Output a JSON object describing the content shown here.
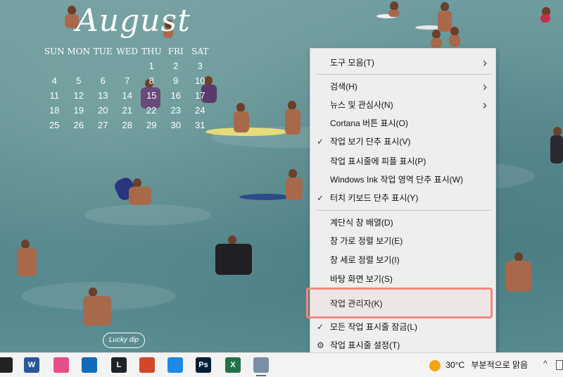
{
  "calendar": {
    "month": "August",
    "weekdays": [
      "SUN",
      "MON",
      "TUE",
      "WED",
      "THU",
      "FRI",
      "SAT"
    ],
    "weeks": [
      [
        "",
        "",
        "",
        "",
        "1",
        "2",
        "3"
      ],
      [
        "4",
        "5",
        "6",
        "7",
        "8",
        "9",
        "10"
      ],
      [
        "11",
        "12",
        "13",
        "14",
        "15",
        "16",
        "17"
      ],
      [
        "18",
        "19",
        "20",
        "21",
        "22",
        "23",
        "24"
      ],
      [
        "25",
        "26",
        "27",
        "28",
        "29",
        "30",
        "31"
      ]
    ],
    "sticker": "Lucky dip"
  },
  "context_menu": {
    "items": [
      {
        "label": "도구 모음(T)",
        "submenu": true,
        "checked": false
      },
      {
        "label": "검색(H)",
        "submenu": true,
        "checked": false
      },
      {
        "label": "뉴스 및 관심사(N)",
        "submenu": true,
        "checked": false
      },
      {
        "label": "Cortana 버튼 표시(O)",
        "submenu": false,
        "checked": false
      },
      {
        "label": "작업 보기 단추 표시(V)",
        "submenu": false,
        "checked": true
      },
      {
        "label": "작업 표시줄에 피플 표시(P)",
        "submenu": false,
        "checked": false
      },
      {
        "label": "Windows Ink 작업 영역 단추 표시(W)",
        "submenu": false,
        "checked": false
      },
      {
        "label": "터치 키보드 단추 표시(Y)",
        "submenu": false,
        "checked": true
      },
      {
        "label": "계단식 창 배열(D)",
        "submenu": false,
        "checked": false
      },
      {
        "label": "창 가로 정렬 보기(E)",
        "submenu": false,
        "checked": false
      },
      {
        "label": "창 세로 정렬 보기(I)",
        "submenu": false,
        "checked": false
      },
      {
        "label": "바탕 화면 보기(S)",
        "submenu": false,
        "checked": false
      },
      {
        "label": "작업 관리자(K)",
        "submenu": false,
        "checked": false,
        "highlighted": true
      },
      {
        "label": "모든 작업 표시줄 잠금(L)",
        "submenu": false,
        "checked": true
      },
      {
        "label": "작업 표시줄 설정(T)",
        "submenu": false,
        "checked": false,
        "icon": "gear-icon"
      }
    ],
    "check_glyph": "✓",
    "arrow_glyph": "›",
    "gear_glyph": "⚙",
    "highlight_color": "#f08a80"
  },
  "taskbar": {
    "apps": [
      {
        "name": "media-app-icon",
        "color": "#222222"
      },
      {
        "name": "word-icon",
        "color": "#2b579a",
        "glyph": "W"
      },
      {
        "name": "snip-tool-icon",
        "color": "#e84d8a"
      },
      {
        "name": "store-icon",
        "color": "#0f6cbd"
      },
      {
        "name": "league-of-legends-icon",
        "color": "#1e2328",
        "glyph": "L"
      },
      {
        "name": "presentation-app-icon",
        "color": "#d24726"
      },
      {
        "name": "arrow-app-icon",
        "color": "#1e88e5"
      },
      {
        "name": "photoshop-icon",
        "color": "#001e36",
        "glyph": "Ps"
      },
      {
        "name": "excel-icon",
        "color": "#217346",
        "glyph": "X"
      },
      {
        "name": "image-viewer-icon",
        "color": "#7a8fa6"
      }
    ],
    "weather": {
      "temp": "30°C",
      "desc": "부분적으로 맑음",
      "icon": "partly-sunny-icon"
    },
    "tray_chevron": "^"
  }
}
